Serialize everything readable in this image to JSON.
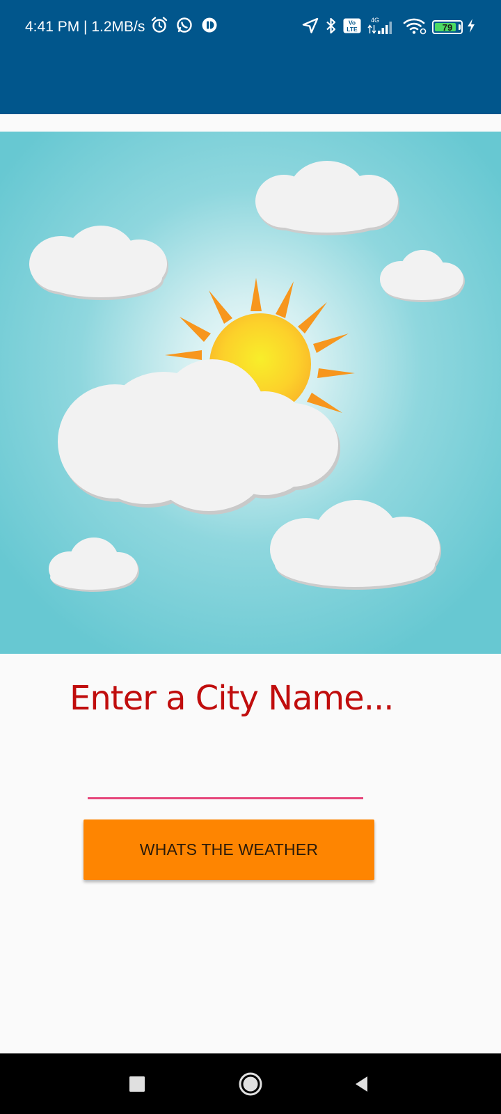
{
  "status_bar": {
    "time": "4:41 PM | 1.2MB/s",
    "battery_level": "79",
    "network_type": "4G",
    "volte_label": "Vo LTE",
    "icons": [
      "alarm-icon",
      "whatsapp-icon",
      "app-icon",
      "location-icon",
      "bluetooth-icon",
      "volte-icon",
      "signal-icon",
      "wifi-icon",
      "battery-icon",
      "charging-icon"
    ]
  },
  "main": {
    "image_alt": "Sun behind clouds weather illustration",
    "prompt": "Enter a City Name...",
    "city_input": {
      "value": "",
      "placeholder": ""
    },
    "button_label": "WHATS THE WEATHER"
  },
  "nav_bar": {
    "icons": [
      "recents-icon",
      "home-icon",
      "back-icon"
    ]
  },
  "colors": {
    "app_bar": "#01568c",
    "sky": "#69c9d3",
    "sun": "#fcd12a",
    "sun_rays": "#f7961d",
    "prompt_text": "#c00d0d",
    "input_underline": "#e6457a",
    "button": "#fe8501",
    "background": "#fafafa"
  }
}
